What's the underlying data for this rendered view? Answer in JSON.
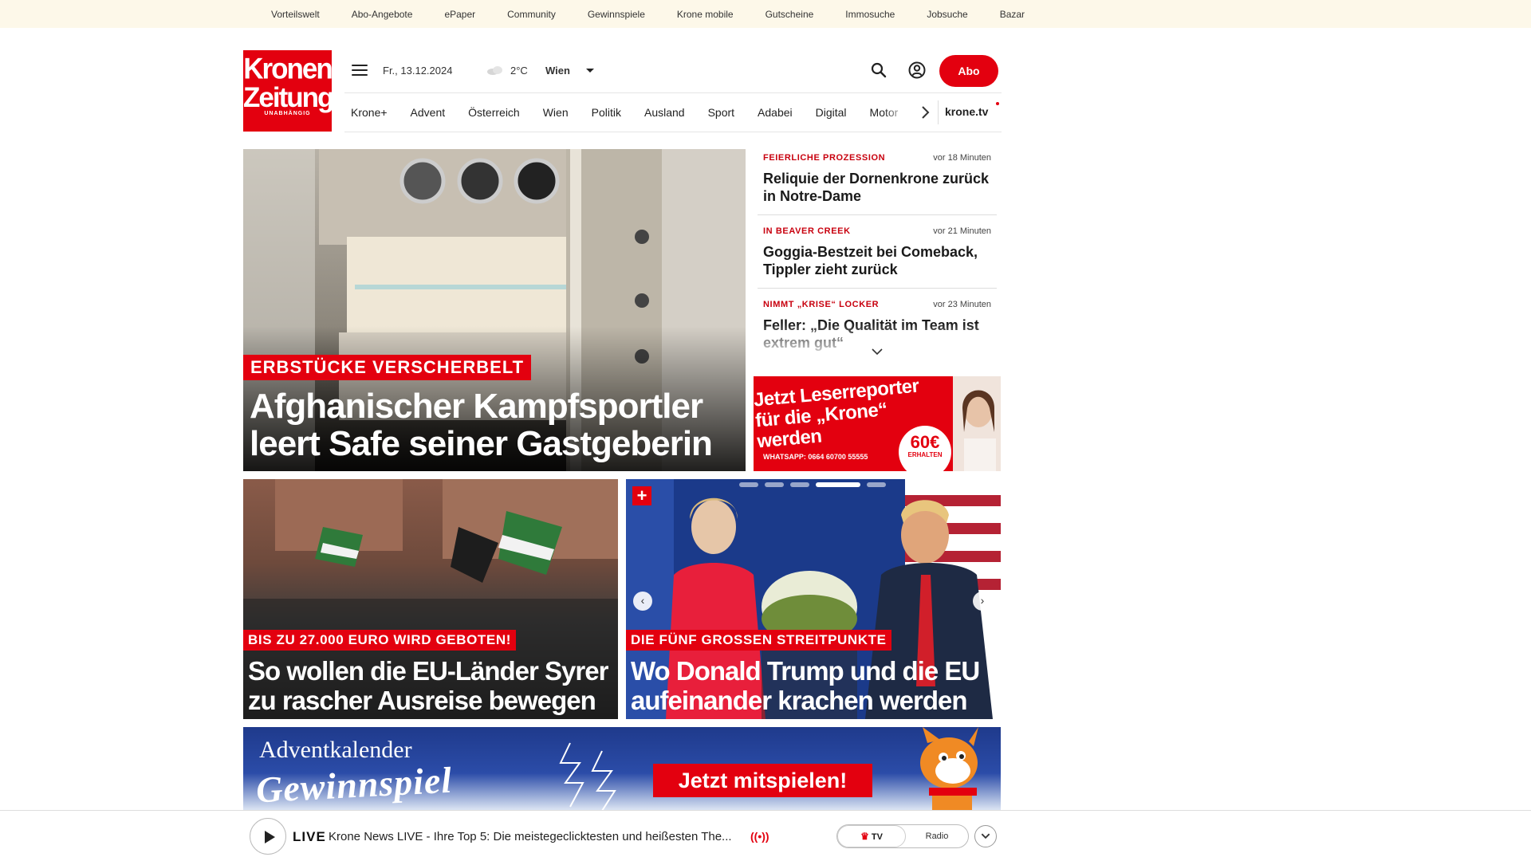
{
  "service_bar": {
    "items": [
      "Vorteilswelt",
      "Abo-Angebote",
      "ePaper",
      "Community",
      "Gewinnspiele",
      "Krone mobile",
      "Gutscheine",
      "Immosuche",
      "Jobsuche",
      "Bazar"
    ]
  },
  "logo": {
    "line1": "Kronen",
    "line2": "Zeitung",
    "tagline": "UNABHÄNGIG"
  },
  "header": {
    "date": "Fr., 13.12.2024",
    "temperature": "2°C",
    "city": "Wien",
    "abo_label": "Abo"
  },
  "nav": {
    "items": [
      "Krone+",
      "Advent",
      "Österreich",
      "Wien",
      "Politik",
      "Ausland",
      "Sport",
      "Adabei",
      "Digital",
      "Motor"
    ],
    "tv_label": "krone.tv"
  },
  "hero": {
    "kicker": "ERBSTÜCKE VERSCHERBELT",
    "title": "Afghanischer Kampfsportler leert Safe seiner Gastgeberin"
  },
  "ticker": {
    "items": [
      {
        "kicker": "FEIERLICHE PROZESSION",
        "time": "vor 18 Minuten",
        "title": "Reliquie der Dornenkrone zurück in Notre-Dame"
      },
      {
        "kicker": "IN BEAVER CREEK",
        "time": "vor 21 Minuten",
        "title": "Goggia-Bestzeit bei Comeback, Tippler zieht zurück"
      },
      {
        "kicker": "NIMMT „KRISE“ LOCKER",
        "time": "vor 23 Minuten",
        "title": "Feller: „Die Qualität im Team ist extrem gut“"
      }
    ]
  },
  "ad_reporter": {
    "headline": "Jetzt Leserreporter für die „Krone“ werden",
    "whatsapp": "WHATSAPP: 0664 60700 55555",
    "amount": "60€",
    "amount_sub": "ERHALTEN"
  },
  "cards": [
    {
      "kicker": "BIS ZU 27.000 EURO WIRD GEBOTEN!",
      "title": "So wollen die EU-Länder Syrer zu rascher Ausreise bewegen"
    },
    {
      "kicker": "DIE FÜNF GROSSEN STREITPUNKTE",
      "title": "Wo Donald Trump und die EU aufeinander krachen werden",
      "badge": "+"
    }
  ],
  "advent": {
    "line1": "Adventkalender",
    "line2": "Gewinnspiel",
    "cta": "Jetzt mitspielen!"
  },
  "player": {
    "live_label": "LIVE",
    "text": "Krone News LIVE - Ihre Top 5: Die meistegeclicktesten und heißesten The...",
    "signal": "((•))",
    "tv_label": "TV",
    "radio_label": "Radio"
  },
  "colors": {
    "brand_red": "#e3000f",
    "service_bar_bg": "#fdf8e9"
  },
  "icons": [
    "hamburger-icon",
    "cloud-icon",
    "search-icon",
    "account-icon",
    "chevron-right-icon",
    "chevron-down-icon",
    "play-icon",
    "broadcast-icon",
    "crown-icon"
  ]
}
